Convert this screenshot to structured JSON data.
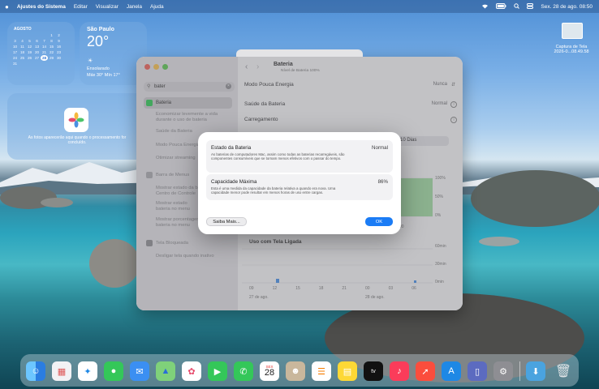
{
  "menubar": {
    "apple": "",
    "app": "Ajustes do Sistema",
    "menus": [
      "Editar",
      "Visualizar",
      "Janela",
      "Ajuda"
    ],
    "datetime": "Sex. 28 de ago.  08:50"
  },
  "desktop": {
    "file_label_1": "Captura de Tela",
    "file_label_2": "2026-0...08.49.58"
  },
  "calendar_widget": {
    "month": "AGOSTO",
    "rows": [
      [
        "",
        "",
        "",
        "",
        "",
        "1",
        "2"
      ],
      [
        "3",
        "4",
        "5",
        "6",
        "7",
        "8",
        "9"
      ],
      [
        "10",
        "11",
        "12",
        "13",
        "14",
        "15",
        "16"
      ],
      [
        "17",
        "18",
        "19",
        "20",
        "21",
        "22",
        "23"
      ],
      [
        "24",
        "25",
        "26",
        "27",
        "28",
        "29",
        "30"
      ],
      [
        "31",
        "",
        "",
        "",
        "",
        "",
        ""
      ]
    ],
    "today": "28"
  },
  "weather_widget": {
    "city": "São Paulo",
    "temp": "20°",
    "condition": "Ensolarado",
    "range": "Máx 30° Mín 17°"
  },
  "photos_widget": {
    "text": "As fotos aparecerão aqui quando o processamento for concluído."
  },
  "settings": {
    "search_value": "bater",
    "sidebar_selected": "Bateria",
    "sidebar_items": [
      "Economizar levemente a vida",
      "durante o uso de bateria",
      "Saúde da Bateria",
      "Modo Pouca Energia",
      "Otimizar streaming",
      "Barra de Menus",
      "Mostrar estado da bateria",
      "Centro de Controle",
      "Mostrar estado",
      "bateria no menu",
      "Mostrar porcentagem",
      "bateria no menu",
      "Tela Bloqueada",
      "Desligar tela quando inativo"
    ],
    "title": "Bateria",
    "subtitle": "Nível de Bateria 100%",
    "rows": {
      "low_power_label": "Modo Pouca Energia",
      "low_power_value": "Nunca",
      "health_label": "Saúde da Bateria",
      "health_value": "Normal",
      "charging_label": "Carregamento"
    },
    "period": "10 Dias",
    "chart": {
      "y_ticks_top": [
        "100%",
        "50%",
        "0%"
      ],
      "y_ticks_bottom": [
        "60min",
        "30min",
        "0min"
      ],
      "x_ticks": [
        "09",
        "12",
        "15",
        "18",
        "21",
        "00",
        "03",
        "06"
      ],
      "date_1": "27 de ago.",
      "date_2": "28 de ago.",
      "screen_time_label": "Uso com Tela Ligada"
    }
  },
  "modal": {
    "state_title": "Estado da Bateria",
    "state_value": "Normal",
    "state_desc": "As baterias de computadores Mac, assim como todas as baterias recarregáveis, são componentes consumíveis que se tornam menos efetivos com o passar do tempo.",
    "capacity_title": "Capacidade Máxima",
    "capacity_value": "86%",
    "capacity_desc": "Esta é uma medida da capacidade da bateria relativa a quando era nova. Uma capacidade menor pode resultar em menos horas de uso entre cargas.",
    "more_button": "Saiba Mais...",
    "ok_button": "OK"
  },
  "dock": {
    "calendar_day": "28",
    "calendar_month": "SEX"
  }
}
